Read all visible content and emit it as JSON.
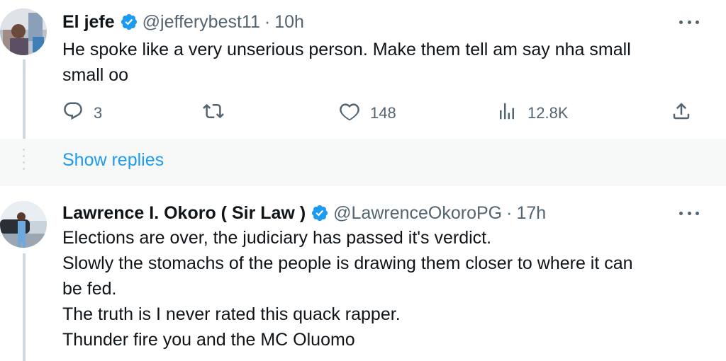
{
  "tweets": [
    {
      "name": "El jefe",
      "handle": "@jefferybest11",
      "separator": "·",
      "time": "10h",
      "text_lines": [
        "He spoke like a very unserious person. Make them tell am say nha small",
        "small oo"
      ],
      "actions": {
        "replies": "3",
        "likes": "148",
        "views": "12.8K"
      }
    },
    {
      "name": "Lawrence I. Okoro ( Sir Law )",
      "handle": "@LawrenceOkoroPG",
      "separator": "·",
      "time": "17h",
      "text_lines": [
        "Elections are over, the judiciary has passed it's verdict.",
        "Slowly the stomachs of the people is drawing them closer to where it can",
        "be fed.",
        "The truth is I never rated this quack rapper.",
        "Thunder fire you and the MC Oluomo"
      ]
    }
  ],
  "show_replies_label": "Show replies",
  "colors": {
    "accent": "#1d9bf0",
    "muted": "#536471",
    "text": "#0f1419",
    "thread_line": "#cfd9de"
  },
  "icons": [
    "verified-badge-icon",
    "more-icon",
    "reply-icon",
    "retweet-icon",
    "like-icon",
    "views-icon",
    "share-icon"
  ]
}
